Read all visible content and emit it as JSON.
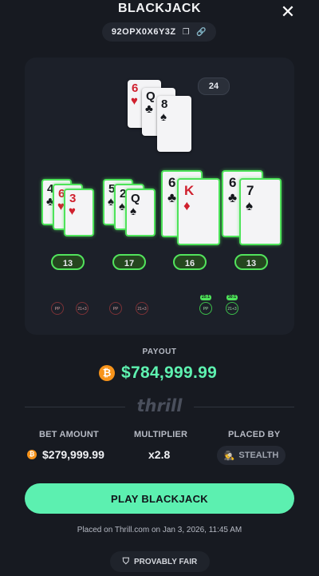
{
  "header": {
    "title": "BLACKJACK",
    "close_icon": "close-icon"
  },
  "game_id": {
    "value": "92OPX0X6Y3Z",
    "copy_icon": "copy-icon",
    "link_icon": "link-icon"
  },
  "shoe_count": "24",
  "dealer": {
    "cards": [
      {
        "rank": "6",
        "suit": "♥",
        "color": "red"
      },
      {
        "rank": "Q",
        "suit": "♣",
        "color": "black"
      },
      {
        "rank": "8",
        "suit": "♠",
        "color": "black"
      }
    ]
  },
  "hands": [
    {
      "cards": [
        {
          "rank": "4",
          "suit": "♣",
          "color": "black"
        },
        {
          "rank": "6",
          "suit": "♥",
          "color": "red"
        },
        {
          "rank": "3",
          "suit": "♥",
          "color": "red"
        }
      ],
      "total": "13",
      "side_bets": [
        "PP",
        "21+3"
      ],
      "side_bet_multipliers": []
    },
    {
      "cards": [
        {
          "rank": "5",
          "suit": "♠",
          "color": "black"
        },
        {
          "rank": "2",
          "suit": "♠",
          "color": "black"
        },
        {
          "rank": "Q",
          "suit": "♠",
          "color": "black"
        }
      ],
      "total": "17",
      "side_bets": [
        "PP",
        "21+3"
      ],
      "side_bet_multipliers": []
    },
    {
      "cards": [
        {
          "rank": "6",
          "suit": "♣",
          "color": "black"
        },
        {
          "rank": "K",
          "suit": "♦",
          "color": "red"
        }
      ],
      "total": "16",
      "side_bets": [
        "PP",
        "21+3"
      ],
      "side_bet_multipliers": [
        "25:1",
        "30:1"
      ]
    },
    {
      "cards": [
        {
          "rank": "6",
          "suit": "♣",
          "color": "black"
        },
        {
          "rank": "7",
          "suit": "♠",
          "color": "black"
        }
      ],
      "total": "13",
      "side_bets": [],
      "side_bet_multipliers": []
    }
  ],
  "payout": {
    "label": "PAYOUT",
    "value": "$784,999.99",
    "currency_icon": "bitcoin-icon",
    "color": "#5ef2b0"
  },
  "brand": "thrill",
  "stats": {
    "bet_amount_label": "BET AMOUNT",
    "bet_amount_value": "$279,999.99",
    "multiplier_label": "MULTIPLIER",
    "multiplier_value": "x2.8",
    "placed_by_label": "PLACED BY",
    "placed_by_value": "STEALTH",
    "placed_by_icon": "incognito-icon"
  },
  "play_button": {
    "label": "PLAY BLACKJACK",
    "color": "#5cf0b0"
  },
  "placed_on": "Placed on Thrill.com on Jan 3, 2026, 11:45 AM",
  "provably_fair": {
    "label": "PROVABLY FAIR",
    "icon": "shield-icon"
  },
  "colors": {
    "background": "#171a21",
    "win_green": "#4ee35a",
    "card_red": "#d0202e"
  }
}
